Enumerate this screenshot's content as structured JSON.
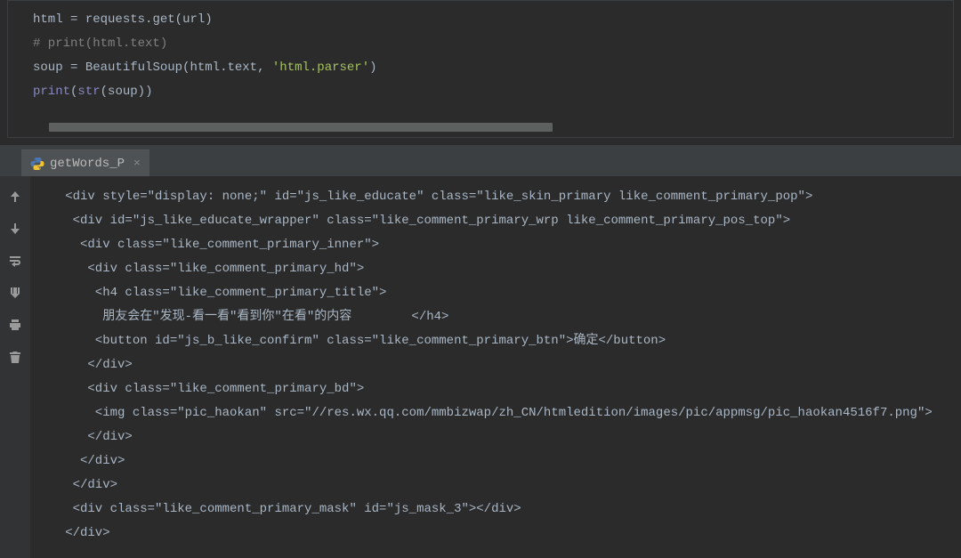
{
  "top_code": {
    "line1": {
      "var": "html",
      "assign": " = ",
      "obj": "requests",
      "dot": ".",
      "method": "get",
      "open": "(",
      "arg": "url",
      "close": ")"
    },
    "line2": "# print(html.text)",
    "line3": {
      "var": "soup",
      "assign": " = ",
      "cls": "BeautifulSoup",
      "open": "(",
      "arg1a": "html",
      "dot1": ".",
      "arg1b": "text",
      "comma": ", ",
      "str": "'html.parser'",
      "close": ")"
    },
    "line4": {
      "fn": "print",
      "open": "(",
      "inner": "str",
      "open2": "(",
      "arg": "soup",
      "close2": ")",
      "close": ")"
    }
  },
  "tab": {
    "label": "getWords_P",
    "close": "×"
  },
  "gutter_icons": {
    "up": "arrow-up-icon",
    "down": "arrow-down-icon",
    "wrap": "soft-wrap-icon",
    "scroll": "scroll-to-end-icon",
    "print": "print-icon",
    "trash": "trash-icon"
  },
  "console_lines": [
    "   <div style=\"display: none;\" id=\"js_like_educate\" class=\"like_skin_primary like_comment_primary_pop\">",
    "    <div id=\"js_like_educate_wrapper\" class=\"like_comment_primary_wrp like_comment_primary_pos_top\">",
    "     <div class=\"like_comment_primary_inner\">",
    "      <div class=\"like_comment_primary_hd\">",
    "       <h4 class=\"like_comment_primary_title\">",
    "        朋友会在\"发现-看一看\"看到你\"在看\"的内容        </h4>",
    "       <button id=\"js_b_like_confirm\" class=\"like_comment_primary_btn\">确定</button>",
    "      </div>",
    "      <div class=\"like_comment_primary_bd\">",
    "       <img class=\"pic_haokan\" src=\"//res.wx.qq.com/mmbizwap/zh_CN/htmledition/images/pic/appmsg/pic_haokan4516f7.png\">",
    "      </div>",
    "     </div>",
    "    </div>",
    "    <div class=\"like_comment_primary_mask\" id=\"js_mask_3\"></div>",
    "   </div>"
  ]
}
